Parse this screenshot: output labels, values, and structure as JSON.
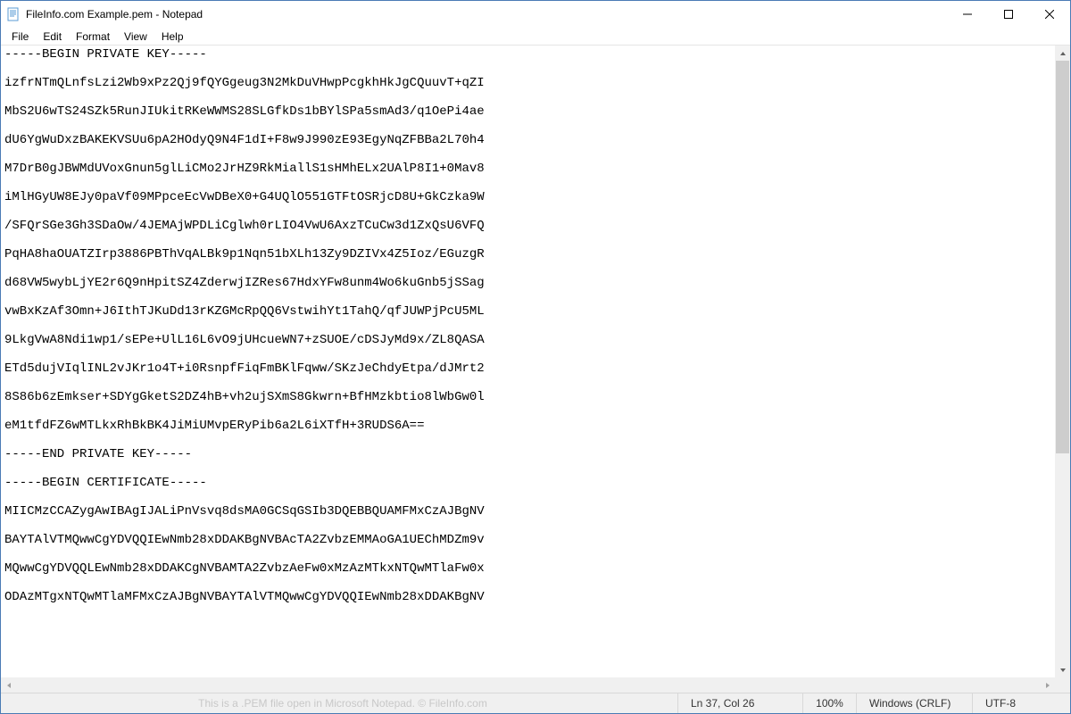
{
  "window": {
    "title": "FileInfo.com Example.pem - Notepad"
  },
  "menu": {
    "file": "File",
    "edit": "Edit",
    "format": "Format",
    "view": "View",
    "help": "Help"
  },
  "editor": {
    "content": "-----BEGIN PRIVATE KEY-----\n\nizfrNTmQLnfsLzi2Wb9xPz2Qj9fQYGgeug3N2MkDuVHwpPcgkhHkJgCQuuvT+qZI\n\nMbS2U6wTS24SZk5RunJIUkitRKeWWMS28SLGfkDs1bBYlSPa5smAd3/q1OePi4ae\n\ndU6YgWuDxzBAKEKVSUu6pA2HOdyQ9N4F1dI+F8w9J990zE93EgyNqZFBBa2L70h4\n\nM7DrB0gJBWMdUVoxGnun5glLiCMo2JrHZ9RkMiallS1sHMhELx2UAlP8I1+0Mav8\n\niMlHGyUW8EJy0paVf09MPpceEcVwDBeX0+G4UQlO551GTFtOSRjcD8U+GkCzka9W\n\n/SFQrSGe3Gh3SDaOw/4JEMAjWPDLiCglwh0rLIO4VwU6AxzTCuCw3d1ZxQsU6VFQ\n\nPqHA8haOUATZIrp3886PBThVqALBk9p1Nqn51bXLh13Zy9DZIVx4Z5Ioz/EGuzgR\n\nd68VW5wybLjYE2r6Q9nHpitSZ4ZderwjIZRes67HdxYFw8unm4Wo6kuGnb5jSSag\n\nvwBxKzAf3Omn+J6IthTJKuDd13rKZGMcRpQQ6VstwihYt1TahQ/qfJUWPjPcU5ML\n\n9LkgVwA8Ndi1wp1/sEPe+UlL16L6vO9jUHcueWN7+zSUOE/cDSJyMd9x/ZL8QASA\n\nETd5dujVIqlINL2vJKr1o4T+i0RsnpfFiqFmBKlFqww/SKzJeChdyEtpa/dJMrt2\n\n8S86b6zEmkser+SDYgGketS2DZ4hB+vh2ujSXmS8Gkwrn+BfHMzkbtio8lWbGw0l\n\neM1tfdFZ6wMTLkxRhBkBK4JiMiUMvpERyPib6a2L6iXTfH+3RUDS6A==\n\n-----END PRIVATE KEY-----\n\n-----BEGIN CERTIFICATE-----\n\nMIICMzCCAZygAwIBAgIJALiPnVsvq8dsMA0GCSqGSIb3DQEBBQUAMFMxCzAJBgNV\n\nBAYTAlVTMQwwCgYDVQQIEwNmb28xDDAKBgNVBAcTA2ZvbzEMMAoGA1UEChMDZm9v\n\nMQwwCgYDVQQLEwNmb28xDDAKCgNVBAMTA2ZvbzAeFw0xMzAzMTkxNTQwMTlaFw0x\n\nODAzMTgxNTQwMTlaMFMxCzAJBgNVBAYTAlVTMQwwCgYDVQQIEwNmb28xDDAKBgNV"
  },
  "status": {
    "watermark": "This is a .PEM file open in Microsoft Notepad. © FileInfo.com",
    "position": "Ln 37, Col 26",
    "zoom": "100%",
    "line_ending": "Windows (CRLF)",
    "encoding": "UTF-8"
  }
}
